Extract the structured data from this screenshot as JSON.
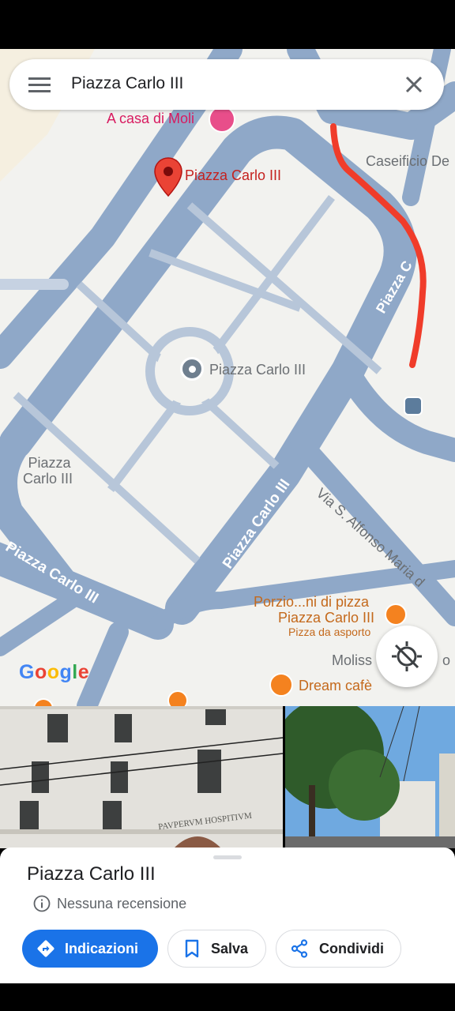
{
  "search": {
    "query": "Piazza Carlo III"
  },
  "map": {
    "labels": {
      "casa_di_moli": "A casa di Moli",
      "pin_label": "Piazza Carlo III",
      "caseificio": "Caseificio De",
      "center_poi": "Piazza Carlo III",
      "left_area_line1": "Piazza",
      "left_area_line2": "Carlo III",
      "street_right": "Piazza C",
      "street_diag_center": "Piazza Carlo III",
      "street_bottom_left": "Piazza Carlo III",
      "street_via": "Via S. Alfonso Maria d",
      "porzio_line1": "Porzio...ni di pizza",
      "porzio_line2": "Piazza Carlo III",
      "porzio_line3": "Pizza da asporto",
      "moliss": "Moliss",
      "moliss_suffix": "o",
      "dream_cafe": "Dream cafè",
      "google_logo": "Google"
    },
    "icons": [
      "hamburger-menu-icon",
      "close-icon",
      "red-pin-icon",
      "poi-marker-icon",
      "bus-stop-icon",
      "restaurant-icon",
      "bar-icon",
      "hotel-icon",
      "locate-me-icon"
    ],
    "colors": {
      "road": "#8fa8c8",
      "land": "#f2f2ef",
      "annotation": "#f03c2a",
      "pin": "#ea4335"
    }
  },
  "photos": [
    {
      "caption": "PAVPERVM HOSPITIVM"
    },
    {
      "caption": ""
    }
  ],
  "place": {
    "title": "Piazza Carlo III",
    "reviews": "Nessuna recensione"
  },
  "actions": {
    "directions": "Indicazioni",
    "save": "Salva",
    "share": "Condividi"
  },
  "accent": "#1a73e8"
}
